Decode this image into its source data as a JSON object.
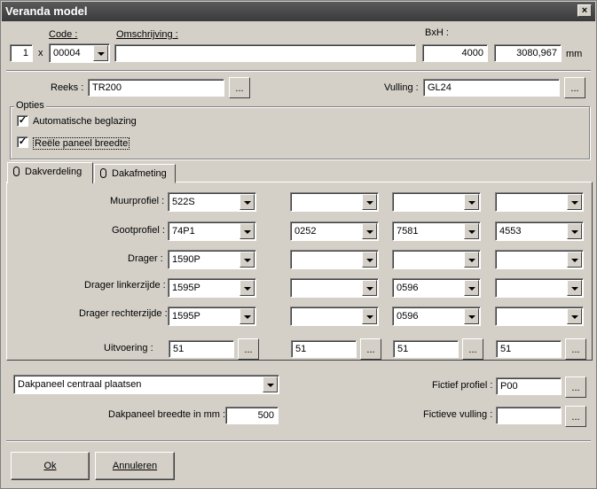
{
  "window": {
    "title": "Veranda model",
    "close": "×"
  },
  "header": {
    "code_label": "Code :",
    "omschrijving_label": "Omschrijving :",
    "bxh_label": "BxH :",
    "quantity": "1",
    "times": "x",
    "code_value": "00004",
    "omschrijving_value": "",
    "b_value": "4000",
    "h_value": "3080,967",
    "unit": "mm"
  },
  "reeks": {
    "label": "Reeks :",
    "value": "TR200",
    "button": "..."
  },
  "vulling": {
    "label": "Vulling :",
    "value": "GL24",
    "button": "..."
  },
  "opties": {
    "title": "Opties",
    "automatische": {
      "label": "Automatische beglazing",
      "checked": "✓"
    },
    "reele": {
      "label": "Reële paneel breedte",
      "checked": "✓"
    }
  },
  "tabs": [
    {
      "label": "Dakverdeling"
    },
    {
      "label": "Dakafmeting"
    }
  ],
  "grid": {
    "rows": [
      {
        "label": "Muurprofiel :",
        "values": [
          "522S",
          "",
          "",
          ""
        ]
      },
      {
        "label": "Gootprofiel :",
        "values": [
          "74P1",
          "0252",
          "7581",
          "4553"
        ]
      },
      {
        "label": "Drager :",
        "values": [
          "1590P",
          "",
          "",
          ""
        ]
      },
      {
        "label": "Drager linkerzijde :",
        "values": [
          "1595P",
          "",
          "0596",
          ""
        ]
      },
      {
        "label": "Drager rechterzijde :",
        "values": [
          "1595P",
          "",
          "0596",
          ""
        ]
      }
    ],
    "uitvoering": {
      "label": "Uitvoering :",
      "values": [
        "51",
        "51",
        "51",
        "51"
      ],
      "button": "..."
    }
  },
  "bottom": {
    "dakpaneel_select": "Dakpaneel centraal plaatsen",
    "breedte_label": "Dakpaneel breedte in mm :",
    "breedte_value": "500",
    "fictief_label": "Fictief profiel :",
    "fictief_value": "P00",
    "fictieve_vulling_label": "Fictieve vulling :",
    "fictieve_vulling_value": "",
    "button": "..."
  },
  "buttons": {
    "ok": "Ok",
    "annuleren": "Annuleren"
  }
}
